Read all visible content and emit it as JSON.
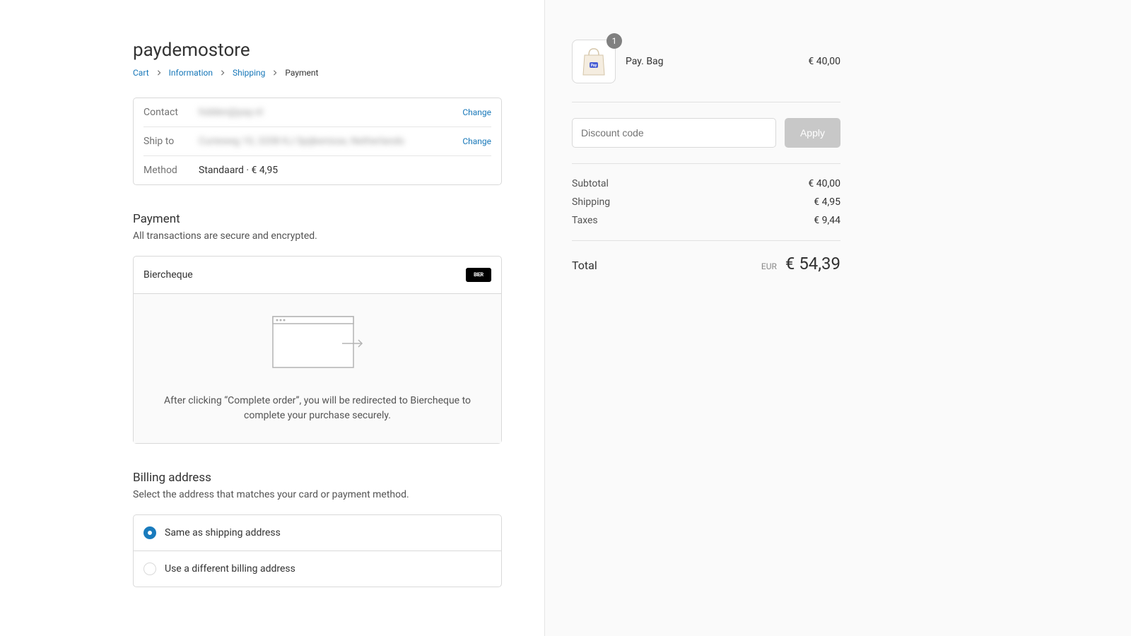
{
  "store_name": "paydemostore",
  "breadcrumbs": {
    "cart": "Cart",
    "information": "Information",
    "shipping": "Shipping",
    "payment": "Payment"
  },
  "review": {
    "contact_label": "Contact",
    "contact_value": "hidden@pay.nl",
    "ship_label": "Ship to",
    "ship_value": "Curieweg 10, 3208 KJ Spijkenisse, Netherlands",
    "method_label": "Method",
    "method_value": "Standaard · € 4,95",
    "change": "Change"
  },
  "payment": {
    "title": "Payment",
    "sub": "All transactions are secure and encrypted.",
    "method_name": "Biercheque",
    "badge_text": "BIER",
    "redirect_text": "After clicking “Complete order”, you will be redirected to Biercheque to complete your purchase securely."
  },
  "billing": {
    "title": "Billing address",
    "sub": "Select the address that matches your card or payment method.",
    "same": "Same as shipping address",
    "different": "Use a different billing address"
  },
  "cart": {
    "item_name": "Pay. Bag",
    "item_price": "€ 40,00",
    "item_qty": "1"
  },
  "discount": {
    "placeholder": "Discount code",
    "apply": "Apply"
  },
  "totals": {
    "subtotal_label": "Subtotal",
    "subtotal": "€ 40,00",
    "shipping_label": "Shipping",
    "shipping": "€ 4,95",
    "taxes_label": "Taxes",
    "taxes": "€ 9,44"
  },
  "grand": {
    "label": "Total",
    "currency": "EUR",
    "amount": "€ 54,39"
  }
}
